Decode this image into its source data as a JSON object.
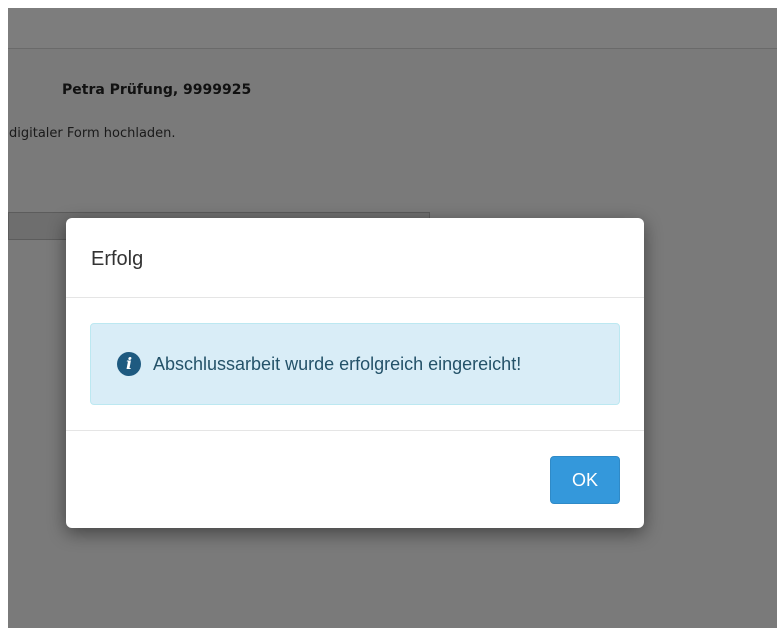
{
  "background": {
    "user_label": "Petra Prüfung, 9999925",
    "hint_text": "digitaler Form hochladen."
  },
  "modal": {
    "title": "Erfolg",
    "message": "Abschlussarbeit wurde erfolgreich eingereicht!",
    "message_icon": "info-icon",
    "ok_label": "OK"
  },
  "colors": {
    "overlay": "#7a7a7a",
    "alert_bg": "#d9edf7",
    "alert_text": "#245269",
    "primary_button": "#3498db"
  }
}
